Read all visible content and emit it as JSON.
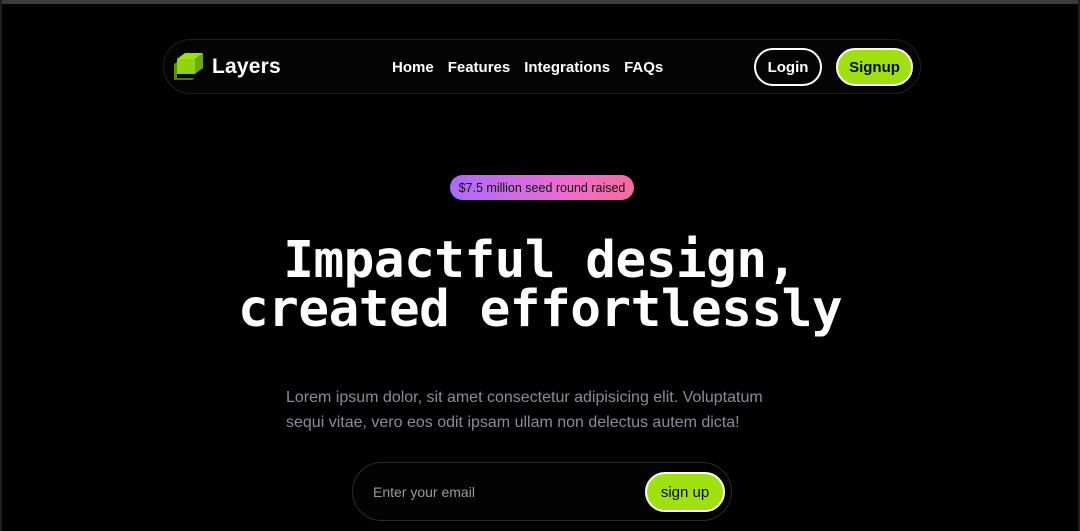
{
  "nav": {
    "brand": "Layers",
    "links": [
      "Home",
      "Features",
      "Integrations",
      "FAQs"
    ],
    "login_label": "Login",
    "signup_label": "Signup"
  },
  "hero": {
    "badge": "$7.5 million seed round raised",
    "headline_line1": "Impactful design,",
    "headline_line2": "created effortlessly",
    "subtext": "Lorem ipsum dolor, sit amet consectetur adipisicing elit. Voluptatum sequi vitae, vero eos odit ipsam ullam non delectus autem dicta!"
  },
  "form": {
    "email_placeholder": "Enter your email",
    "submit_label": "sign up"
  },
  "icons": {
    "logo": "layers-logo-icon"
  },
  "colors": {
    "accent": "#9ee10f",
    "background": "#010101",
    "badge_gradient_start": "#a96bff",
    "badge_gradient_end": "#f76b9c",
    "muted_text": "#8c8c95"
  }
}
